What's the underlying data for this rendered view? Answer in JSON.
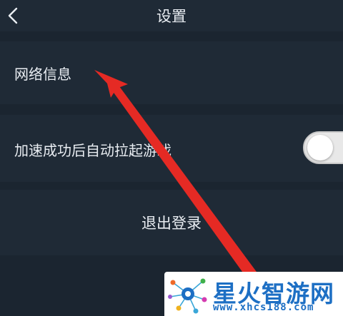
{
  "header": {
    "back_icon": "chevron-left-icon",
    "title": "设置"
  },
  "settings": {
    "network_info_label": "网络信息",
    "auto_launch_label": "加速成功后自动拉起游戏",
    "auto_launch_enabled": false,
    "logout_label": "退出登录"
  },
  "annotation": {
    "arrow_color": "#e52a24",
    "arrow_target": "网络信息"
  },
  "watermark": {
    "title": "星火智游网",
    "url": "www.xhcs188.com",
    "color": "#1d6fc4"
  },
  "colors": {
    "background": "#1b2530",
    "row": "#1f2a36",
    "text": "#e9edf2"
  }
}
